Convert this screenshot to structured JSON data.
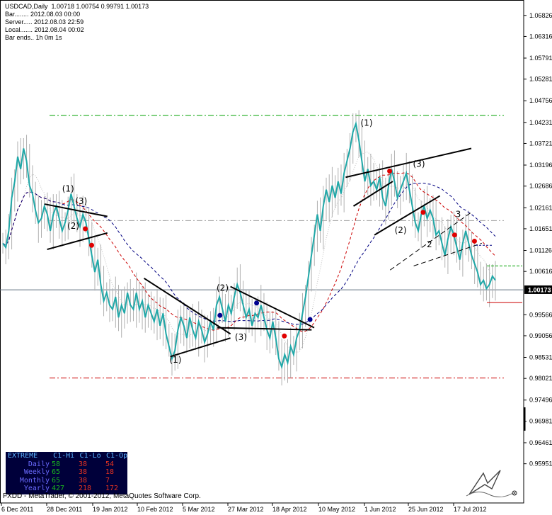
{
  "info": {
    "symbol_line": "USDCAD,Daily  1.00718 1.00754 0.99791 1.00173",
    "bar": "Bar........ 2012.08.03 00:00",
    "server": "Server..... 2012.08.03 22:59",
    "local": "Local....... 2012.08.04 00:02",
    "bar_ends": "Bar ends.. 1h 0m 1s"
  },
  "chart_data": {
    "type": "line",
    "title": "USDCAD,Daily",
    "ylim": [
      0.95,
      1.072
    ],
    "y_ticks": [
      "1.06826",
      "1.06316",
      "1.05791",
      "1.05281",
      "1.04756",
      "1.04231",
      "1.03721",
      "1.03196",
      "1.02686",
      "1.02161",
      "1.01651",
      "1.01126",
      "1.00616",
      "1.00173",
      "0.99566",
      "0.99056",
      "0.98531",
      "0.98021",
      "0.97496",
      "0.96981",
      "0.96461",
      "0.95951"
    ],
    "x_ticks": [
      "6 Dec 2011",
      "28 Dec 2011",
      "19 Jan 2012",
      "10 Feb 2012",
      "5 Mar 2012",
      "27 Mar 2012",
      "18 Apr 2012",
      "10 May 2012",
      "1 Jun 2012",
      "25 Jun 2012",
      "17 Jul 2012"
    ],
    "current_price": "1.00173",
    "grid": false,
    "series": [
      {
        "color": "#20a8a8",
        "values": [
          1.013,
          1.012,
          1.016,
          1.024,
          1.028,
          1.034,
          1.031,
          1.036,
          1.033,
          1.027,
          1.025,
          1.021,
          1.018,
          1.019,
          1.022,
          1.02,
          1.016,
          1.02,
          1.022,
          1.019,
          1.016,
          1.018,
          1.021,
          1.025,
          1.022,
          1.019,
          1.017,
          1.02,
          1.018,
          1.014,
          1.01,
          1.006,
          1.009,
          1.003,
          0.999,
          1.001,
          0.998,
          0.997,
          1.0,
          0.995,
          0.998,
          0.996,
          1.001,
          0.998,
          0.997,
          1.001,
          0.997,
          0.999,
          0.995,
          0.998,
          0.996,
          0.994,
          0.997,
          0.993,
          0.996,
          0.991,
          0.988,
          0.985,
          0.987,
          0.992,
          0.995,
          0.993,
          0.99,
          0.995,
          0.992,
          0.99,
          0.994,
          0.992,
          0.989,
          0.991,
          0.994,
          0.992,
          0.998,
          1.0,
          0.997,
          0.994,
          0.998,
          0.996,
          1.0,
          1.003,
          1.001,
          0.998,
          0.995,
          0.997,
          0.993,
          0.996,
          0.995,
          0.998,
          0.995,
          0.992,
          0.99,
          0.994,
          0.99,
          0.985,
          0.983,
          0.986,
          0.984,
          0.988,
          0.986,
          0.99,
          0.992,
          0.996,
          1.0,
          1.005,
          1.01,
          1.015,
          1.02,
          1.016,
          1.022,
          1.026,
          1.023,
          1.027,
          1.024,
          1.028,
          1.025,
          1.03,
          1.033,
          1.036,
          1.04,
          1.042,
          1.038,
          1.033,
          1.028,
          1.031,
          1.027,
          1.028,
          1.026,
          1.029,
          1.024,
          1.022,
          1.027,
          1.031,
          1.028,
          1.024,
          1.026,
          1.028,
          1.03,
          1.026,
          1.022,
          1.018,
          1.016,
          1.02,
          1.022,
          1.019,
          1.021,
          1.019,
          1.015,
          1.016,
          1.013,
          1.01,
          1.014,
          1.017,
          1.015,
          1.012,
          1.009,
          1.013,
          1.016,
          1.013,
          1.01,
          1.008,
          1.006,
          1.003,
          1.004,
          1.002,
          1.003,
          1.005,
          1.004
        ]
      }
    ],
    "moving_averages": [
      {
        "color": "#c0c0c0",
        "style": "dot"
      },
      {
        "color": "#cc0000",
        "style": "dash"
      },
      {
        "color": "#000080",
        "style": "dash"
      }
    ],
    "levels": [
      {
        "value": 1.044,
        "color": "#00a000",
        "style": "dashdot"
      },
      {
        "value": 1.0185,
        "color": "#a0a0a0",
        "style": "dashdot"
      },
      {
        "value": 0.9803,
        "color": "#cc0000",
        "style": "dashdot"
      },
      {
        "value": 1.0017,
        "color": "#607080",
        "style": "solid"
      }
    ],
    "wave_labels": [
      "(1)",
      "(3)",
      "(2)",
      "(2)",
      "(1)",
      "(3)",
      "(1)",
      "(3)",
      "(2)",
      "3",
      "2"
    ]
  },
  "stats_table": {
    "header": [
      "EXTREME",
      "C1-Hi",
      "C1-Lo",
      "C1-Op"
    ],
    "rows": [
      {
        "label": "Daily",
        "v": [
          "58",
          "38",
          "54"
        ]
      },
      {
        "label": "Weekly",
        "v": [
          "65",
          "38",
          "18"
        ]
      },
      {
        "label": "Monthly",
        "v": [
          "65",
          "38",
          "7"
        ]
      },
      {
        "label": "Yearly",
        "v": [
          "427",
          "218",
          "172"
        ]
      }
    ]
  },
  "footer": {
    "copyright": "FXDD - MetaTrader, © 2001-2012, MetaQuotes Software Corp."
  },
  "colors": {
    "price": "#20a8a8",
    "bar_shadow": "#b0b0b0",
    "dot_red": "#e00000",
    "dot_blue": "#000090",
    "stats_bg": "#00003a"
  }
}
